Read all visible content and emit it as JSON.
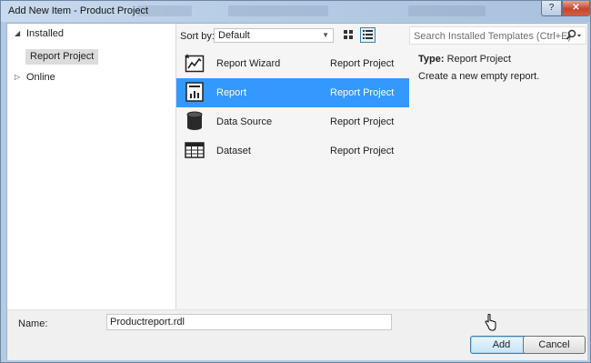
{
  "window": {
    "title": "Add New Item - Product Project"
  },
  "tree": {
    "installed_label": "Installed",
    "installed_child": "Report Project",
    "online_label": "Online"
  },
  "toolbar": {
    "sort_label": "Sort by:",
    "sort_value": "Default"
  },
  "templates": [
    {
      "name": "Report Wizard",
      "category": "Report Project",
      "icon": "report-wizard-icon"
    },
    {
      "name": "Report",
      "category": "Report Project",
      "icon": "report-icon",
      "selected": true
    },
    {
      "name": "Data Source",
      "category": "Report Project",
      "icon": "database-icon"
    },
    {
      "name": "Dataset",
      "category": "Report Project",
      "icon": "dataset-table-icon"
    }
  ],
  "search": {
    "placeholder": "Search Installed Templates (Ctrl+E)"
  },
  "details": {
    "type_label": "Type:",
    "type_value": "Report Project",
    "description": "Create a new empty report."
  },
  "name_field": {
    "label": "Name:",
    "value": "Productreport.rdl"
  },
  "buttons": {
    "add": "Add",
    "cancel": "Cancel"
  },
  "colors": {
    "selection": "#3399ff",
    "close_button": "#c7452c"
  }
}
